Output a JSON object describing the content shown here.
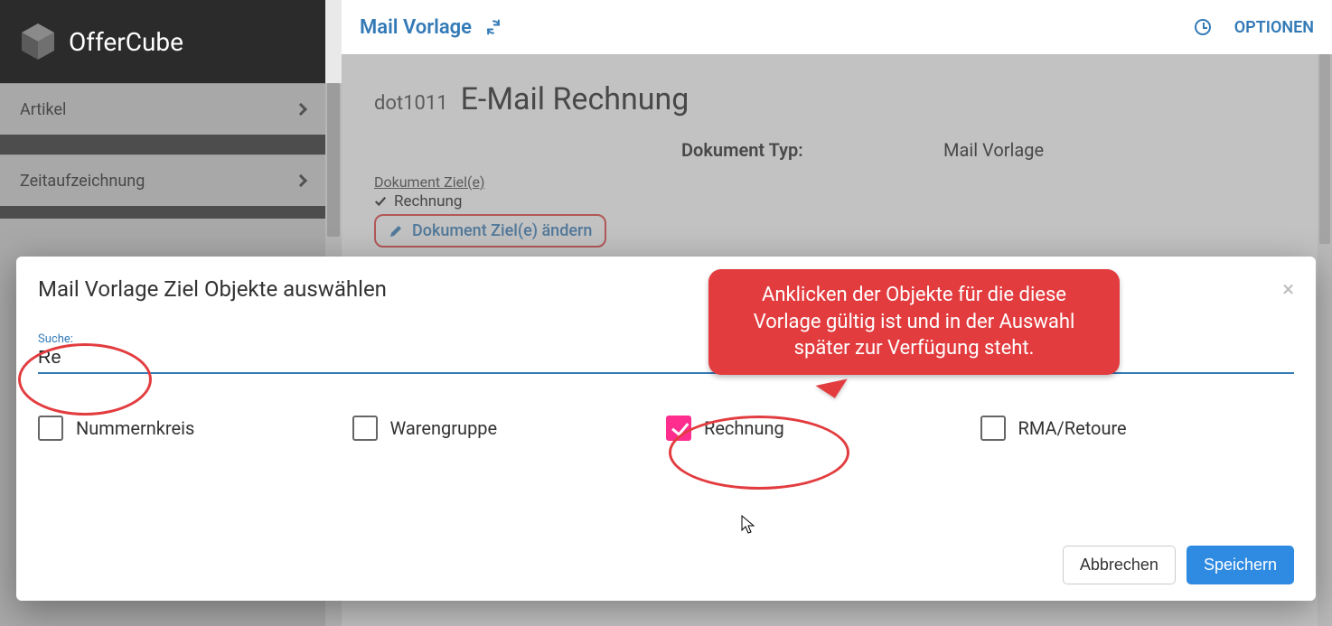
{
  "brand": {
    "name": "OfferCube"
  },
  "sidebar": {
    "items": [
      {
        "label": "Artikel"
      },
      {
        "label": "Zeitaufzeichnung"
      }
    ]
  },
  "topbar": {
    "title": "Mail Vorlage",
    "options": "OPTIONEN"
  },
  "page": {
    "code": "dot1011",
    "name": "E-Mail Rechnung",
    "doc_type_label": "Dokument Typ:",
    "doc_type_value": "Mail Vorlage",
    "doc_ziel_label": "Dokument Ziel(e)",
    "doc_ziel_value": "Rechnung",
    "edit_link": "Dokument Ziel(e) ändern"
  },
  "modal": {
    "title": "Mail Vorlage Ziel Objekte auswählen",
    "search_label": "Suche:",
    "search_value": "Re",
    "options": [
      {
        "label": "Nummernkreis",
        "checked": false
      },
      {
        "label": "Warengruppe",
        "checked": false
      },
      {
        "label": "Rechnung",
        "checked": true
      },
      {
        "label": "RMA/Retoure",
        "checked": false
      }
    ],
    "cancel": "Abbrechen",
    "save": "Speichern"
  },
  "callout": {
    "text": "Anklicken der Objekte für die diese Vorlage gültig ist und in der Auswahl später zur Verfügung steht."
  },
  "colors": {
    "accent_blue": "#337ab7",
    "annotation_red": "#e23c3f",
    "checkbox_pink": "#ff2d8d"
  }
}
